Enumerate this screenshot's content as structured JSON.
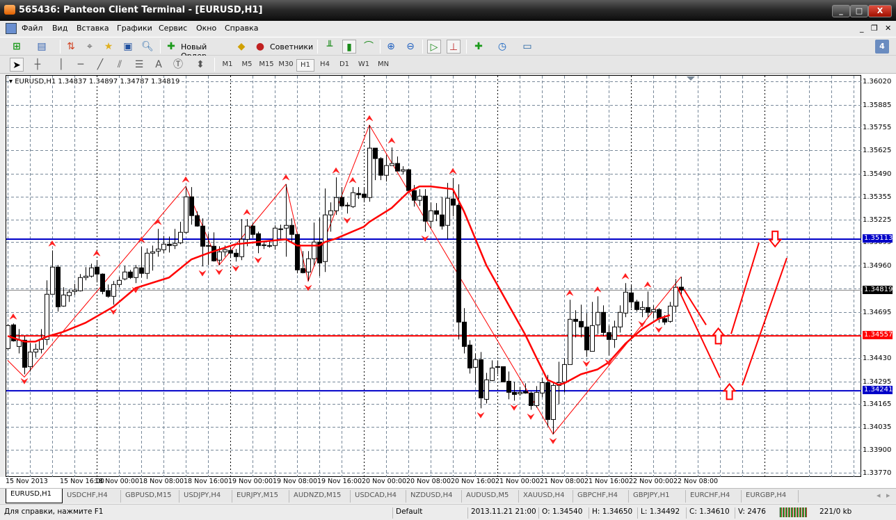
{
  "window": {
    "title": "565436: Panteon Client Terminal - [EURUSD,H1]",
    "minimize": "_",
    "maximize": "□",
    "close": "X"
  },
  "menu": {
    "items": [
      "Файл",
      "Вид",
      "Вставка",
      "Графики",
      "Сервис",
      "Окно",
      "Справка"
    ],
    "mdi_min": "_",
    "mdi_restore": "❐",
    "mdi_close": "✕"
  },
  "toolbar": {
    "new_order": "Новый Ордер",
    "experts": "Советники",
    "notifications_count": "4"
  },
  "timeframes": {
    "items": [
      "M1",
      "M5",
      "M15",
      "M30",
      "H1",
      "H4",
      "D1",
      "W1",
      "MN"
    ],
    "active": "H1"
  },
  "chart": {
    "header": "EURUSD,H1  1.34837 1.34897 1.34787 1.34819",
    "symbol": "EURUSD",
    "timeframe": "H1",
    "price_ticks": [
      "1.36020",
      "1.35885",
      "1.35755",
      "1.35625",
      "1.35490",
      "1.35355",
      "1.35225",
      "1.35095",
      "1.34960",
      "1.34830",
      "1.34695",
      "1.34565",
      "1.34430",
      "1.34295",
      "1.34165",
      "1.34035",
      "1.33900",
      "1.33770"
    ],
    "time_labels": [
      "15 Nov 2013",
      "15 Nov 16:00",
      "18 Nov 00:00",
      "18 Nov 08:00",
      "18 Nov 16:00",
      "19 Nov 00:00",
      "19 Nov 08:00",
      "19 Nov 16:00",
      "20 Nov 00:00",
      "20 Nov 08:00",
      "20 Nov 16:00",
      "21 Nov 00:00",
      "21 Nov 08:00",
      "21 Nov 16:00",
      "22 Nov 00:00",
      "22 Nov 08:00"
    ],
    "hlines": [
      {
        "price": "1.35113",
        "color": "#0000c8"
      },
      {
        "price": "1.34557",
        "color": "#ff0000"
      },
      {
        "price": "1.34241",
        "color": "#0000c8"
      }
    ],
    "bid": {
      "price": "1.34819",
      "color": "#000000"
    },
    "colors": {
      "bull": "#ffffff",
      "bear": "#000000",
      "ma": "#ff0000",
      "zigzag": "#ff0000",
      "grid": "#778899"
    }
  },
  "chart_data": {
    "type": "candlestick",
    "ylim": [
      1.3377,
      1.3602
    ],
    "ohlc": [
      [
        1.34484,
        1.34624,
        1.34476,
        1.34616
      ],
      [
        1.3462,
        1.34628,
        1.34524,
        1.34528
      ],
      [
        1.34496,
        1.34596,
        1.34456,
        1.34532
      ],
      [
        1.34532,
        1.34556,
        1.34336,
        1.34376
      ],
      [
        1.3438,
        1.34516,
        1.34352,
        1.34464
      ],
      [
        1.34464,
        1.34512,
        1.34432,
        1.3448
      ],
      [
        1.3448,
        1.34596,
        1.34456,
        1.34536
      ],
      [
        1.34536,
        1.34876,
        1.34504,
        1.34796
      ],
      [
        1.34796,
        1.35048,
        1.34796,
        1.34952
      ],
      [
        1.34952,
        1.34964,
        1.34696,
        1.34724
      ],
      [
        1.34728,
        1.34836,
        1.34724,
        1.34792
      ],
      [
        1.34788,
        1.34824,
        1.34752,
        1.34808
      ],
      [
        1.34812,
        1.34856,
        1.34792,
        1.3482
      ],
      [
        1.34816,
        1.34912,
        1.34812,
        1.34892
      ],
      [
        1.34892,
        1.34952,
        1.34876,
        1.349
      ],
      [
        1.349,
        1.34972,
        1.34892,
        1.34948
      ],
      [
        1.34952,
        1.34992,
        1.34864,
        1.34912
      ],
      [
        1.34912,
        1.34916,
        1.34796,
        1.34812
      ],
      [
        1.34816,
        1.34852,
        1.34776,
        1.34784
      ],
      [
        1.34784,
        1.34872,
        1.34736,
        1.34852
      ],
      [
        1.34852,
        1.34896,
        1.34836,
        1.34876
      ],
      [
        1.34884,
        1.3496,
        1.34876,
        1.34924
      ],
      [
        1.34924,
        1.34936,
        1.34884,
        1.34892
      ],
      [
        1.34892,
        1.34964,
        1.3486,
        1.34948
      ],
      [
        1.34948,
        1.35068,
        1.34892,
        1.34916
      ],
      [
        1.34916,
        1.3506,
        1.34884,
        1.35032
      ],
      [
        1.35032,
        1.35076,
        1.34932,
        1.3504
      ],
      [
        1.35044,
        1.35172,
        1.35012,
        1.35056
      ],
      [
        1.35052,
        1.35132,
        1.35032,
        1.35084
      ],
      [
        1.35084,
        1.35128,
        1.35036,
        1.35076
      ],
      [
        1.35076,
        1.35172,
        1.35056,
        1.35088
      ],
      [
        1.35092,
        1.35212,
        1.35084,
        1.35152
      ],
      [
        1.35152,
        1.35416,
        1.35144,
        1.35356
      ],
      [
        1.35356,
        1.35412,
        1.35196,
        1.35248
      ],
      [
        1.35248,
        1.35272,
        1.35184,
        1.35188
      ],
      [
        1.35188,
        1.35232,
        1.34956,
        1.35072
      ],
      [
        1.35076,
        1.35144,
        1.34964,
        1.35072
      ],
      [
        1.35072,
        1.35152,
        1.34984,
        1.34988
      ],
      [
        1.34992,
        1.35072,
        1.34964,
        1.3504
      ],
      [
        1.3504,
        1.35076,
        1.35012,
        1.35052
      ],
      [
        1.35048,
        1.35076,
        1.35004,
        1.35032
      ],
      [
        1.35032,
        1.35056,
        1.34984,
        1.35012
      ],
      [
        1.35012,
        1.35228,
        1.34992,
        1.35112
      ],
      [
        1.35112,
        1.35228,
        1.35072,
        1.35188
      ],
      [
        1.35188,
        1.35204,
        1.3512,
        1.3514
      ],
      [
        1.35144,
        1.35156,
        1.35032,
        1.35076
      ],
      [
        1.35076,
        1.35096,
        1.35056,
        1.3508
      ],
      [
        1.35076,
        1.35104,
        1.35064,
        1.35072
      ],
      [
        1.35076,
        1.35192,
        1.35052,
        1.35176
      ],
      [
        1.35168,
        1.35196,
        1.35116,
        1.35172
      ],
      [
        1.35176,
        1.35428,
        1.35012,
        1.35192
      ],
      [
        1.35192,
        1.35232,
        1.35092,
        1.3514
      ],
      [
        1.3514,
        1.35144,
        1.34916,
        1.34936
      ],
      [
        1.34944,
        1.35044,
        1.34916,
        1.3492
      ],
      [
        1.34924,
        1.35044,
        1.34872,
        1.35
      ],
      [
        1.35,
        1.35208,
        1.34964,
        1.35096
      ],
      [
        1.35096,
        1.35236,
        1.349,
        1.34976
      ],
      [
        1.34984,
        1.35404,
        1.34924,
        1.35252
      ],
      [
        1.35252,
        1.35324,
        1.35156,
        1.35276
      ],
      [
        1.35276,
        1.35468,
        1.35252,
        1.35352
      ],
      [
        1.35352,
        1.35412,
        1.35296,
        1.35304
      ],
      [
        1.35308,
        1.35324,
        1.3526,
        1.35304
      ],
      [
        1.353,
        1.35412,
        1.35292,
        1.3538
      ],
      [
        1.35376,
        1.35412,
        1.35344,
        1.35368
      ],
      [
        1.35372,
        1.35412,
        1.35324,
        1.35352
      ],
      [
        1.35352,
        1.35768,
        1.35328,
        1.35636
      ],
      [
        1.35636,
        1.35636,
        1.35452,
        1.35576
      ],
      [
        1.35576,
        1.35584,
        1.35452,
        1.3548
      ],
      [
        1.3548,
        1.35596,
        1.35444,
        1.35536
      ],
      [
        1.35536,
        1.3564,
        1.35536,
        1.35548
      ],
      [
        1.35548,
        1.35588,
        1.35504,
        1.35504
      ],
      [
        1.35504,
        1.35532,
        1.35484,
        1.35512
      ],
      [
        1.35512,
        1.35516,
        1.35392,
        1.35392
      ],
      [
        1.35392,
        1.35424,
        1.353,
        1.35336
      ],
      [
        1.35336,
        1.354,
        1.35304,
        1.3536
      ],
      [
        1.3536,
        1.354,
        1.35156,
        1.35216
      ],
      [
        1.35216,
        1.35324,
        1.35176,
        1.35276
      ],
      [
        1.35276,
        1.3532,
        1.35216,
        1.35256
      ],
      [
        1.35252,
        1.35356,
        1.35168,
        1.35188
      ],
      [
        1.35192,
        1.35436,
        1.35112,
        1.35348
      ],
      [
        1.35344,
        1.35464,
        1.35244,
        1.35308
      ],
      [
        1.35308,
        1.35428,
        1.34536,
        1.34636
      ],
      [
        1.34636,
        1.34716,
        1.34456,
        1.34496
      ],
      [
        1.34504,
        1.34532,
        1.3434,
        1.34372
      ],
      [
        1.34376,
        1.34456,
        1.34284,
        1.3442
      ],
      [
        1.3442,
        1.34464,
        1.3414,
        1.342
      ],
      [
        1.34192,
        1.34344,
        1.34168,
        1.34304
      ],
      [
        1.343,
        1.34416,
        1.34296,
        1.34372
      ],
      [
        1.3438,
        1.34416,
        1.34336,
        1.34376
      ],
      [
        1.3438,
        1.3438,
        1.34292,
        1.34292
      ],
      [
        1.34296,
        1.34352,
        1.34192,
        1.34232
      ],
      [
        1.34232,
        1.34292,
        1.34184,
        1.3422
      ],
      [
        1.34224,
        1.34264,
        1.34212,
        1.34232
      ],
      [
        1.34236,
        1.34284,
        1.34224,
        1.34228
      ],
      [
        1.34228,
        1.34236,
        1.34132,
        1.34156
      ],
      [
        1.34156,
        1.34268,
        1.34144,
        1.34232
      ],
      [
        1.34228,
        1.34316,
        1.34204,
        1.34288
      ],
      [
        1.34288,
        1.34332,
        1.34036,
        1.34076
      ],
      [
        1.34076,
        1.34284,
        1.33992,
        1.34272
      ],
      [
        1.34272,
        1.34408,
        1.34164,
        1.34288
      ],
      [
        1.34292,
        1.34428,
        1.34232,
        1.34392
      ],
      [
        1.34392,
        1.34764,
        1.34392,
        1.34652
      ],
      [
        1.34652,
        1.34704,
        1.34548,
        1.3464
      ],
      [
        1.3464,
        1.34736,
        1.34548,
        1.34608
      ],
      [
        1.34608,
        1.34688,
        1.34436,
        1.34476
      ],
      [
        1.34468,
        1.34752,
        1.34468,
        1.34616
      ],
      [
        1.3462,
        1.34784,
        1.34568,
        1.34692
      ],
      [
        1.34692,
        1.34732,
        1.34556,
        1.34576
      ],
      [
        1.34576,
        1.34616,
        1.34444,
        1.34536
      ],
      [
        1.34536,
        1.34644,
        1.34488,
        1.34608
      ],
      [
        1.34608,
        1.34732,
        1.34576,
        1.34692
      ],
      [
        1.34688,
        1.3486,
        1.34664,
        1.34808
      ],
      [
        1.34804,
        1.34852,
        1.34716,
        1.34752
      ],
      [
        1.34752,
        1.34764,
        1.34696,
        1.34708
      ],
      [
        1.34708,
        1.34756,
        1.34664,
        1.3472
      ],
      [
        1.3472,
        1.34812,
        1.34664,
        1.34692
      ],
      [
        1.34696,
        1.34732,
        1.34656,
        1.34708
      ],
      [
        1.34708,
        1.34716,
        1.34632,
        1.34656
      ],
      [
        1.34656,
        1.34676,
        1.3462,
        1.34636
      ],
      [
        1.3464,
        1.34752,
        1.34632,
        1.34728
      ],
      [
        1.34728,
        1.34884,
        1.34692,
        1.34836
      ],
      [
        1.34837,
        1.34897,
        1.34787,
        1.34819
      ]
    ],
    "moving_average": [
      [
        0,
        1.34556
      ],
      [
        3,
        1.34524
      ],
      [
        5,
        1.34524
      ],
      [
        7,
        1.34552
      ],
      [
        10,
        1.3458
      ],
      [
        14,
        1.34632
      ],
      [
        19,
        1.34724
      ],
      [
        23,
        1.34832
      ],
      [
        29,
        1.34892
      ],
      [
        33,
        1.34996
      ],
      [
        36,
        1.35032
      ],
      [
        41,
        1.35084
      ],
      [
        50,
        1.35112
      ],
      [
        52,
        1.35076
      ],
      [
        56,
        1.35076
      ],
      [
        57,
        1.35096
      ],
      [
        59,
        1.35116
      ],
      [
        64,
        1.35184
      ],
      [
        65,
        1.35212
      ],
      [
        69,
        1.35292
      ],
      [
        72,
        1.35384
      ],
      [
        74,
        1.35416
      ],
      [
        76,
        1.35416
      ],
      [
        80,
        1.354
      ],
      [
        82,
        1.35272
      ],
      [
        86,
        1.34964
      ],
      [
        93,
        1.34564
      ],
      [
        95,
        1.34432
      ],
      [
        97,
        1.34304
      ],
      [
        99,
        1.34276
      ],
      [
        100,
        1.34284
      ],
      [
        103,
        1.34336
      ],
      [
        106,
        1.34364
      ],
      [
        108,
        1.34404
      ],
      [
        111,
        1.34512
      ],
      [
        114,
        1.34596
      ],
      [
        117,
        1.34656
      ],
      [
        119,
        1.34676
      ]
    ],
    "zigzag": [
      [
        0,
        1.34416
      ],
      [
        3,
        1.3432
      ],
      [
        32,
        1.35416
      ],
      [
        38,
        1.34964
      ],
      [
        50,
        1.35428
      ],
      [
        54,
        1.34872
      ],
      [
        65,
        1.35768
      ],
      [
        98,
        1.33992
      ],
      [
        121,
        1.34896
      ]
    ],
    "fractals_up": [
      1,
      8,
      16,
      24,
      27,
      32,
      43,
      50,
      59,
      62,
      65,
      69,
      80,
      101,
      106,
      111,
      115
    ],
    "fractals_down": [
      3,
      19,
      23,
      35,
      38,
      41,
      45,
      54,
      61,
      75,
      85,
      91,
      94,
      98,
      104,
      108,
      114,
      117
    ],
    "projection_lines": [
      [
        [
          121.5,
          1.34824
        ],
        [
          125.5,
          1.3462
        ]
      ],
      [
        [
          120.3,
          1.3484
        ],
        [
          128,
          1.34316
        ]
      ],
      [
        [
          130,
          1.34568
        ],
        [
          135,
          1.35092
        ]
      ],
      [
        [
          132,
          1.34272
        ],
        [
          140,
          1.35004
        ]
      ]
    ],
    "projection_arrows": [
      {
        "bar": 127.7,
        "price": 1.3456,
        "dir": "up"
      },
      {
        "bar": 129.7,
        "price": 1.3424,
        "dir": "up"
      },
      {
        "bar": 137.9,
        "price": 1.3511,
        "dir": "down"
      }
    ]
  },
  "tabs": {
    "items": [
      "EURUSD,H1",
      "USDCHF,H4",
      "GBPUSD,M15",
      "USDJPY,H4",
      "EURJPY,M15",
      "AUDNZD,M15",
      "USDCAD,H4",
      "NZDUSD,H4",
      "AUDUSD,M5",
      "XAUUSD,H4",
      "GBPCHF,H4",
      "GBPJPY,H1",
      "EURCHF,H4",
      "EURGBP,H4"
    ],
    "active": "EURUSD,H1"
  },
  "status": {
    "help": "Для справки, нажмите F1",
    "profile": "Default",
    "datetime": "2013.11.21 21:00",
    "open": "O: 1.34540",
    "high": "H: 1.34650",
    "low": "L: 1.34492",
    "close": "C: 1.34610",
    "volume": "V: 2476",
    "traffic": "221/0 kb"
  }
}
